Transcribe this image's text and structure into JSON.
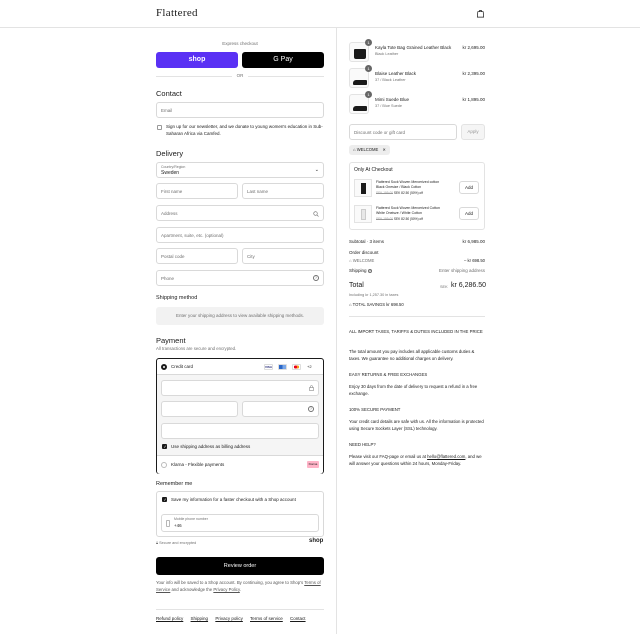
{
  "header": {
    "logo": "Flattered",
    "cart_icon": "bag-icon"
  },
  "express": {
    "label": "Express checkout",
    "shop_pay": "shop",
    "google_pay": "G Pay",
    "or": "OR"
  },
  "contact": {
    "title": "Contact",
    "email_placeholder": "Email",
    "newsletter": "Sign up for our newsletter, and we donate to young women's education in Sub-Saharan Africa via Camfed."
  },
  "delivery": {
    "title": "Delivery",
    "country_label": "Country/Region",
    "country_value": "Sweden",
    "first_name": "First name",
    "last_name": "Last name",
    "address": "Address",
    "apartment": "Apartment, suite, etc. (optional)",
    "postal": "Postal code",
    "city": "City",
    "phone": "Phone"
  },
  "shipping_method": {
    "title": "Shipping method",
    "placeholder": "Enter your shipping address to view available shipping methods."
  },
  "payment": {
    "title": "Payment",
    "subtitle": "All transactions are secure and encrypted.",
    "credit_card": "Credit card",
    "card_logos": [
      "VISA",
      "",
      ""
    ],
    "more_cards": "+2",
    "billing_same": "Use shipping address as billing address",
    "klarna": "Klarna - Flexible payments",
    "klarna_badge": "Klarna"
  },
  "remember": {
    "title": "Remember me",
    "save_info": "Save my information for a faster checkout with a Shop account",
    "phone_label": "Mobile phone number",
    "phone_value": "+46",
    "secure": "Secure and encrypted",
    "shop": "shop"
  },
  "review_button": "Review order",
  "legal": {
    "text": "Your info will be saved to a Shop account. By continuing, you agree to Shop's",
    "terms": "Terms of Service",
    "and": "and acknowledge the",
    "privacy": "Privacy Policy",
    "end": "."
  },
  "footer_links": [
    "Refund policy",
    "Shipping",
    "Privacy policy",
    "Terms of service",
    "Contact"
  ],
  "cart": {
    "items": [
      {
        "qty": "1",
        "name": "Kayla Tote Bag Grained Leather Black",
        "variant": "Black Leather",
        "price": "kr 2,695.00"
      },
      {
        "qty": "1",
        "name": "Blaise Leather Black",
        "variant": "37 / Black Leather",
        "price": "kr 2,395.00"
      },
      {
        "qty": "1",
        "name": "Mimi Suede Blue",
        "variant": "37 / Blue Suede",
        "price": "kr 1,895.00"
      }
    ],
    "discount_placeholder": "Discount code or gift card",
    "apply": "Apply",
    "code_tag": "WELCOME",
    "only_at_checkout": "Only At Checkout",
    "upsells": [
      {
        "name": "Flattered Sock Woven Mercerized cotton Black Onesize / Black Cotton",
        "price_old": "SEK 199.00",
        "price_new": "SEK 82.50 (50%) off",
        "add": "Add"
      },
      {
        "name": "Flattered Sock Woven Mercerized Cotton White Oneisze / White Cotton",
        "price_old": "SEK 199.00",
        "price_new": "SEK 82.50 (50%) off",
        "add": "Add"
      }
    ],
    "subtotal_label": "Subtotal · 3 items",
    "subtotal_value": "kr 6,985.00",
    "order_discount": "Order discount",
    "discount_code": "WELCOME",
    "discount_value": "– kr 698.50",
    "shipping_label": "Shipping",
    "shipping_value": "Enter shipping address",
    "total_label": "Total",
    "total_currency": "SEK",
    "total_value": "kr 6,286.50",
    "tax_note": "Including kr 1,257.30 in taxes",
    "savings": "TOTAL SAVINGS kr 698.50"
  },
  "info": {
    "taxes_title": "ALL IMPORT TAXES, TARIFFS & DUTIES INCLUDED IN THE PRICE",
    "taxes_body": "The total amount you pay includes all applicable customs duties & taxes. We guarantee no additional charges on delivery.",
    "returns_title": "EASY RETURNS & FREE EXCHANGES",
    "returns_body": "Enjoy 30 days from the date of delivery to request a refund in a free exchange.",
    "secure_title": "100% SECURE PAYMENT",
    "secure_body": "Your credit card details are safe with us. All the information is protected using Secure Sockets Layer (SSL) technology.",
    "help_title": "NEED HELP?",
    "help_body_1": "Please visit our FAQ-page or email us at",
    "help_email": "hello@flattered.com",
    "help_body_2": ", and we will answer your questions within 24 hours, Monday-Friday."
  }
}
